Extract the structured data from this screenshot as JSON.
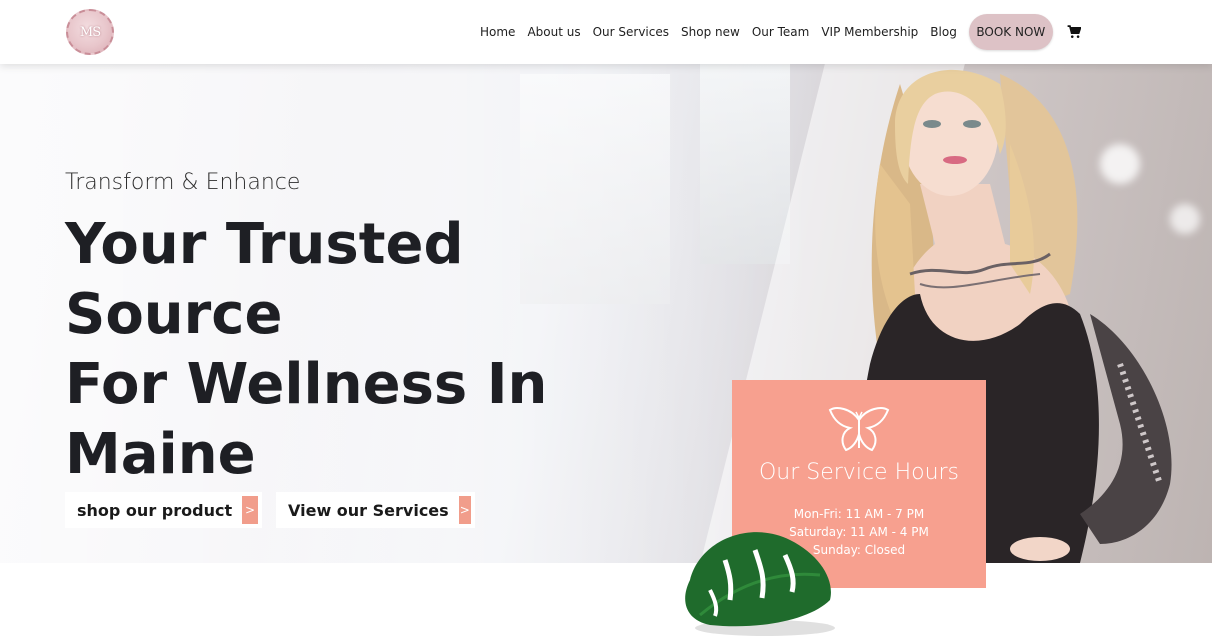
{
  "header": {
    "logo_text": "MS",
    "nav": [
      {
        "label": "Home"
      },
      {
        "label": "About us"
      },
      {
        "label": "Our Services"
      },
      {
        "label": "Shop new"
      },
      {
        "label": "Our Team"
      },
      {
        "label": "VIP Membership"
      },
      {
        "label": "Blog"
      }
    ],
    "book_label": "BOOK NOW",
    "cart_icon": "cart-icon"
  },
  "hero": {
    "eyebrow": "Transform & Enhance",
    "headline_lines": [
      "Your Trusted",
      "Source",
      "For Wellness In",
      "Maine"
    ],
    "cta_primary": {
      "label": "shop our product",
      "arrow": ">"
    },
    "cta_secondary": {
      "label": "View our Services",
      "arrow": ">"
    }
  },
  "service_hours": {
    "icon": "butterfly-icon",
    "title": "Our Service Hours",
    "lines": [
      "Mon-Fri: 11 AM - 7 PM",
      "Saturday: 11 AM - 4 PM",
      "Sunday: Closed"
    ]
  },
  "colors": {
    "accent_coral": "#f7a08f",
    "book_button": "#ddc2c6",
    "heading": "#1e1f24"
  }
}
